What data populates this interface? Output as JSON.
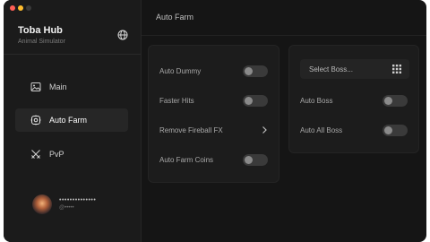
{
  "app": {
    "title": "Toba Hub",
    "subtitle": "Animal Simulator"
  },
  "sidebar": {
    "items": [
      {
        "label": "Main",
        "icon": "image-icon",
        "active": false
      },
      {
        "label": "Auto Farm",
        "icon": "gear-icon",
        "active": true
      },
      {
        "label": "PvP",
        "icon": "crossed-swords-icon",
        "active": false
      }
    ],
    "user": {
      "name": "••••••••••••••",
      "handle": "@•••••"
    }
  },
  "header": {
    "title": "Auto Farm"
  },
  "left_panel": {
    "rows": [
      {
        "label": "Auto Dummy",
        "control": "toggle",
        "on": false
      },
      {
        "label": "Faster Hits",
        "control": "toggle",
        "on": false
      },
      {
        "label": "Remove Fireball FX",
        "control": "chevron"
      },
      {
        "label": "Auto Farm Coins",
        "control": "toggle",
        "on": false
      }
    ]
  },
  "right_panel": {
    "select": {
      "placeholder": "Select Boss..."
    },
    "rows": [
      {
        "label": "Auto Boss",
        "control": "toggle",
        "on": false
      },
      {
        "label": "Auto All Boss",
        "control": "toggle",
        "on": false
      }
    ]
  },
  "colors": {
    "window_bg": "#151515",
    "sidebar_bg": "#1b1b1b",
    "panel_bg": "#1c1c1c",
    "active_item_bg": "#262626",
    "toggle_off": "#3a3a3a"
  }
}
